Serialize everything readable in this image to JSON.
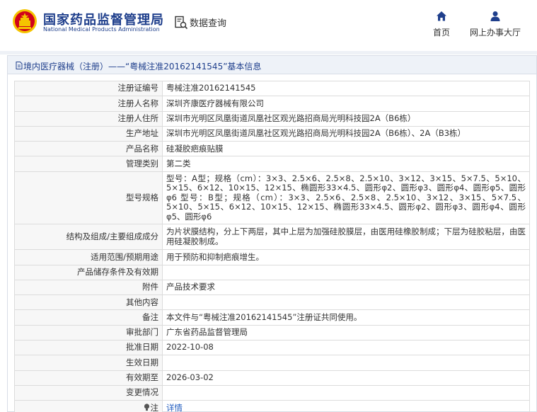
{
  "header": {
    "brand_cn": "国家药品监督管理局",
    "brand_en": "National Medical Products Administration",
    "query_label": "数据查询",
    "nav": {
      "home_label": "首页",
      "office_label": "网上办事大厅"
    }
  },
  "panel": {
    "title": "境内医疗器械（注册）——“粤械注准20162141545”基本信息"
  },
  "rows": [
    {
      "key": "注册证编号",
      "value": "粤械注准20162141545"
    },
    {
      "key": "注册人名称",
      "value": "深圳齐康医疗器械有限公司"
    },
    {
      "key": "注册人住所",
      "value": "深圳市光明区凤凰街道凤凰社区观光路招商局光明科技园2A（B6栋）"
    },
    {
      "key": "生产地址",
      "value": "深圳市光明区凤凰街道凤凰社区观光路招商局光明科技园2A（B6栋）、2A（B3栋）"
    },
    {
      "key": "产品名称",
      "value": "硅凝胶疤痕贴膜"
    },
    {
      "key": "管理类别",
      "value": "第二类"
    },
    {
      "key": "型号规格",
      "value": "型号：A型；规格（cm）：3×3、2.5×6、2.5×8、2.5×10、3×12、3×15、5×7.5、5×10、5×15、6×12、10×15、12×15、椭圆形33×4.5、圆形φ2、圆形φ3、圆形φ4、圆形φ5、圆形φ6 型号：B型；规格（cm）：3×3、2.5×6、2.5×8、2.5×10、3×12、3×15、5×7.5、5×10、5×15、6×12、10×15、12×15、椭圆形33×4.5、圆形φ2、圆形φ3、圆形φ4、圆形φ5、圆形φ6"
    },
    {
      "key": "结构及组成/主要组成成分",
      "value": "为片状膜结构，分上下两层，其中上层为加强硅胶膜层，由医用硅橡胶制成；下层为硅胶粘层，由医用硅凝胶制成。"
    },
    {
      "key": "适用范围/预期用途",
      "value": "用于预防和抑制疤痕增生。"
    },
    {
      "key": "产品储存条件及有效期",
      "value": ""
    },
    {
      "key": "附件",
      "value": "产品技术要求"
    },
    {
      "key": "其他内容",
      "value": ""
    },
    {
      "key": "备注",
      "value": "本文件与“粤械注准20162141545”注册证共同使用。"
    },
    {
      "key": "审批部门",
      "value": "广东省药品监督管理局"
    },
    {
      "key": "批准日期",
      "value": "2022-10-08"
    },
    {
      "key": "生效日期",
      "value": ""
    },
    {
      "key": "有效期至",
      "value": "2026-03-02"
    },
    {
      "key": "变更情况",
      "value": ""
    },
    {
      "key": "注",
      "value": "详情"
    }
  ],
  "colors": {
    "brand": "#1f3f8c",
    "link": "#1f5bbf",
    "logo_red": "#d0021b",
    "logo_gold": "#f5c400"
  },
  "icons": {
    "logo": "national-emblem-icon",
    "query": "search-document-icon",
    "home": "home-icon",
    "office": "user-icon",
    "title": "document-icon",
    "note": "lightbulb-icon"
  }
}
